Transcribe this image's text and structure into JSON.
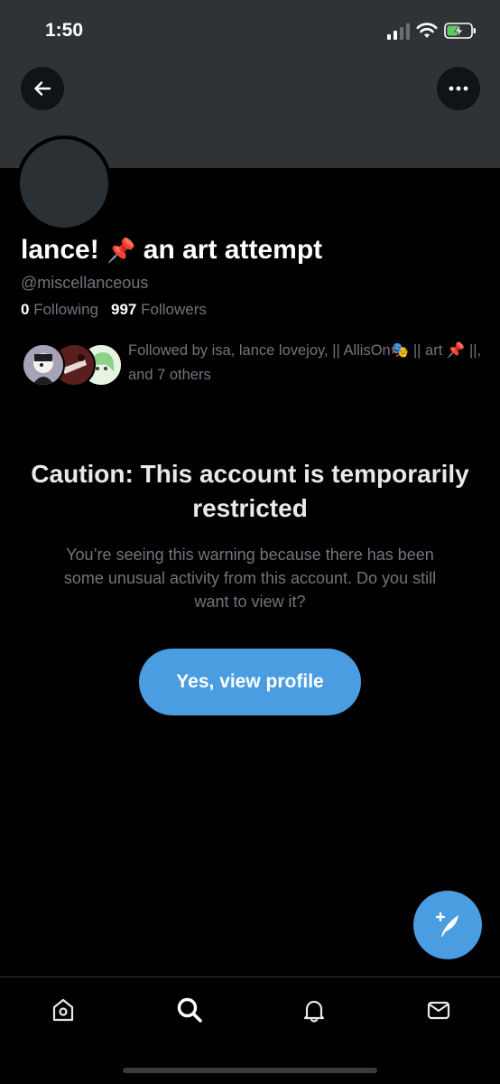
{
  "status_bar": {
    "time": "1:50"
  },
  "header": {
    "back_icon": "arrow-left-icon",
    "more_icon": "ellipsis-icon"
  },
  "profile": {
    "display_name": "lance!",
    "display_name_emoji": "📌",
    "display_name_suffix": "an art attempt",
    "handle": "@miscellanceous",
    "following_count": "0",
    "following_label": "Following",
    "followers_count": "997",
    "followers_label": "Followers",
    "followed_by_text": "Followed by isa, lance lovejoy, || AllisOn🎭 || art 📌 ||, and 7 others"
  },
  "warning": {
    "title": "Caution: This account is temporarily restricted",
    "body": "You’re seeing this warning because there has been some unusual activity from this account. Do you still want to view it?",
    "button_label": "Yes, view profile"
  },
  "fab": {
    "icon": "compose-tweet-icon"
  },
  "tab_bar": {
    "items": [
      {
        "name": "home",
        "icon": "home-icon"
      },
      {
        "name": "search",
        "icon": "search-icon"
      },
      {
        "name": "notifications",
        "icon": "bell-icon"
      },
      {
        "name": "messages",
        "icon": "mail-icon"
      }
    ]
  },
  "colors": {
    "background": "#000000",
    "banner": "#2f3336",
    "accent": "#4a9de0",
    "secondary_text": "#71767b",
    "primary_text": "#e7e9ea"
  }
}
